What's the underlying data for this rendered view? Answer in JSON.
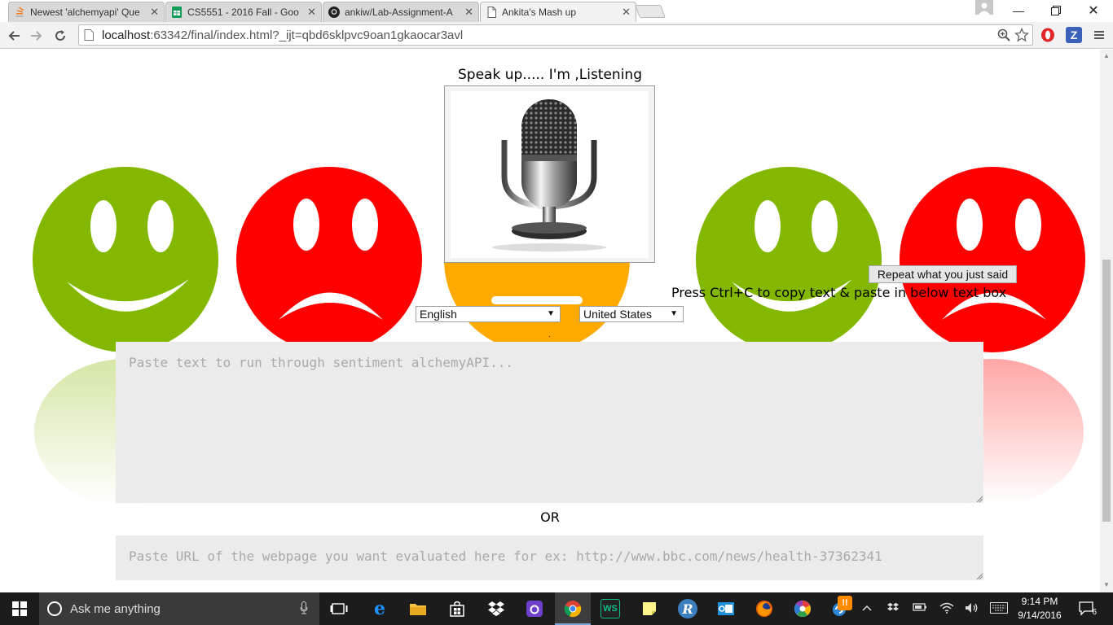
{
  "browser": {
    "tabs": [
      {
        "label": "Newest 'alchemyapi' Que",
        "icon": "stackoverflow-icon",
        "active": false
      },
      {
        "label": "CS5551 - 2016 Fall - Goo",
        "icon": "sheets-icon",
        "active": false
      },
      {
        "label": "ankiw/Lab-Assignment-A",
        "icon": "github-icon",
        "active": false
      },
      {
        "label": "Ankita's Mash up",
        "icon": "page-icon",
        "active": true
      }
    ],
    "address": {
      "host": "localhost",
      "rest": ":63342/final/index.html?_ijt=qbd6sklpvc9oan1gkaocar3avl"
    },
    "extensions": [
      {
        "name": "opera-extension-icon",
        "glyph": "O",
        "color": "#e2262a"
      },
      {
        "name": "zotero-extension-icon",
        "glyph": "Z",
        "color": "#3b62b8"
      }
    ]
  },
  "page": {
    "heading": "Speak up..... I'm ,Listening",
    "repeat_button": "Repeat what you just said",
    "copy_hint": "Press Ctrl+C to copy text & paste in below text box",
    "language_select": {
      "value": "English"
    },
    "country_select": {
      "value": "United States"
    },
    "dot": ".",
    "text_placeholder": "Paste text to run through sentiment alchemyAPI...",
    "or_label": "OR",
    "url_placeholder": "Paste URL of the webpage you want evaluated here for ex: http://www.bbc.com/news/health-37362341",
    "colors": {
      "happy": "#84b800",
      "sad": "#ff0000",
      "neutral": "#ffaa00",
      "field": "#ebebeb"
    }
  },
  "taskbar": {
    "search_placeholder": "Ask me anything",
    "time": "9:14 PM",
    "date": "9/14/2016",
    "notification_count": "6",
    "badge": "!!"
  }
}
